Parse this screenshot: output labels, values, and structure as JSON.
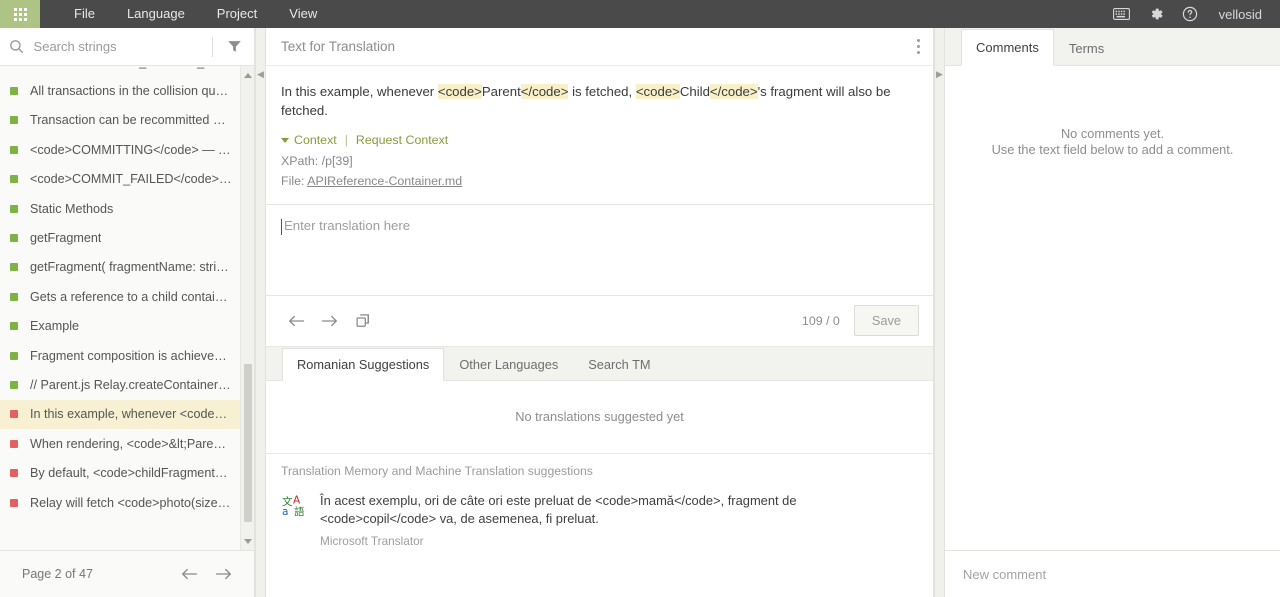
{
  "topbar": {
    "apps_icon": "apps-grid-icon",
    "menu": [
      {
        "label": "File"
      },
      {
        "label": "Language"
      },
      {
        "label": "Project"
      },
      {
        "label": "View"
      }
    ],
    "icons": [
      {
        "name": "keyboard-icon"
      },
      {
        "name": "gear-icon"
      },
      {
        "name": "help-icon"
      }
    ],
    "username": "vellosid"
  },
  "sidebar": {
    "search": {
      "placeholder": "Search strings",
      "value": "",
      "icon": "search-icon"
    },
    "filter_icon": "filter-funnel-icon",
    "items": [
      {
        "label": "<code>COLLISION_COMMIT_FAILED...",
        "status": "green",
        "selected": false
      },
      {
        "label": "All transactions in the collision queu...",
        "status": "green",
        "selected": false
      },
      {
        "label": "Transaction can be recommitted or ...",
        "status": "green",
        "selected": false
      },
      {
        "label": "<code>COMMITTING</code> — Tra...",
        "status": "green",
        "selected": false
      },
      {
        "label": "<code>COMMIT_FAILED</code> — T...",
        "status": "green",
        "selected": false
      },
      {
        "label": "Static Methods",
        "status": "green",
        "selected": false
      },
      {
        "label": "getFragment",
        "status": "green",
        "selected": false
      },
      {
        "label": "getFragment( fragmentName: string...",
        "status": "green",
        "selected": false
      },
      {
        "label": "Gets a reference to a child container...",
        "status": "green",
        "selected": false
      },
      {
        "label": "Example",
        "status": "green",
        "selected": false
      },
      {
        "label": "Fragment composition is achieved vi...",
        "status": "green",
        "selected": false
      },
      {
        "label": "// Parent.js Relay.createContainer(P...",
        "status": "green",
        "selected": false
      },
      {
        "label": "In this example, whenever <code>P...",
        "status": "red",
        "selected": true
      },
      {
        "label": "When rendering, <code>&lt;Parent&...",
        "status": "red",
        "selected": false
      },
      {
        "label": "By default, <code>childFragment</c...",
        "status": "red",
        "selected": false
      },
      {
        "label": "Relay will fetch <code>photo(size: 6...",
        "status": "red",
        "selected": false
      }
    ],
    "scroll_up_icon": "scroll-up-arrow-icon",
    "scroll_down_icon": "scroll-down-arrow-icon",
    "pager": {
      "label": "Page 2 of 47",
      "prev_icon": "arrow-left-icon",
      "next_icon": "arrow-right-icon"
    }
  },
  "center": {
    "header": {
      "title": "Text for Translation",
      "collapse_left_icon": "chevron-left-icon",
      "collapse_right_icon": "chevron-right-icon",
      "menu_icon": "kebab-menu-icon"
    },
    "source": {
      "parts": [
        {
          "t": "In this example, whenever ",
          "hl": false
        },
        {
          "t": "<code>",
          "hl": true
        },
        {
          "t": "Parent",
          "hl": false
        },
        {
          "t": "</code>",
          "hl": true
        },
        {
          "t": " is fetched, ",
          "hl": false
        },
        {
          "t": "<code>",
          "hl": true
        },
        {
          "t": "Child",
          "hl": false
        },
        {
          "t": "</code>",
          "hl": true
        },
        {
          "t": "'s fragment will also be fetched.",
          "hl": false
        }
      ],
      "plain": "In this example, whenever <code>Parent</code> is fetched, <code>Child</code>'s fragment will also be fetched."
    },
    "context": {
      "toggle_label": "Context",
      "separator": "|",
      "request_label": "Request Context",
      "xpath_label": "XPath:",
      "xpath_value": "/p[39]",
      "file_label": "File:",
      "file_value": "APIReference-Container.md"
    },
    "editor": {
      "placeholder": "Enter translation here",
      "value": ""
    },
    "toolbar": {
      "prev_icon": "arrow-left-icon",
      "next_icon": "arrow-right-icon",
      "copy_icon": "copy-source-icon",
      "counter": "109 / 0",
      "save_label": "Save"
    },
    "suggestions": {
      "tabs": [
        {
          "label": "Romanian Suggestions",
          "active": true
        },
        {
          "label": "Other Languages",
          "active": false
        },
        {
          "label": "Search TM",
          "active": false
        }
      ],
      "empty_text": "No translations suggested yet",
      "tm_header": "Translation Memory and Machine Translation suggestions",
      "items": [
        {
          "icon": "machine-translation-icon",
          "text": "În acest exemplu, ori de câte ori este preluat de <code>mamă</code>, fragment de <code>copil</code> va, de asemenea, fi preluat.",
          "source": "Microsoft Translator"
        }
      ]
    }
  },
  "rightpane": {
    "tabs": [
      {
        "label": "Comments",
        "active": true
      },
      {
        "label": "Terms",
        "active": false
      }
    ],
    "empty": {
      "line1": "No comments yet.",
      "line2": "Use the text field below to add a comment."
    },
    "new_comment": {
      "placeholder": "New comment",
      "value": ""
    }
  },
  "colors": {
    "brand_green": "#aec485",
    "topbar": "#4a4a4a",
    "status_green": "#7cb342",
    "status_red": "#e4605e",
    "selected_row": "#f7f0d2",
    "code_highlight": "#faf0c8",
    "context_link": "#8a9a3c"
  }
}
